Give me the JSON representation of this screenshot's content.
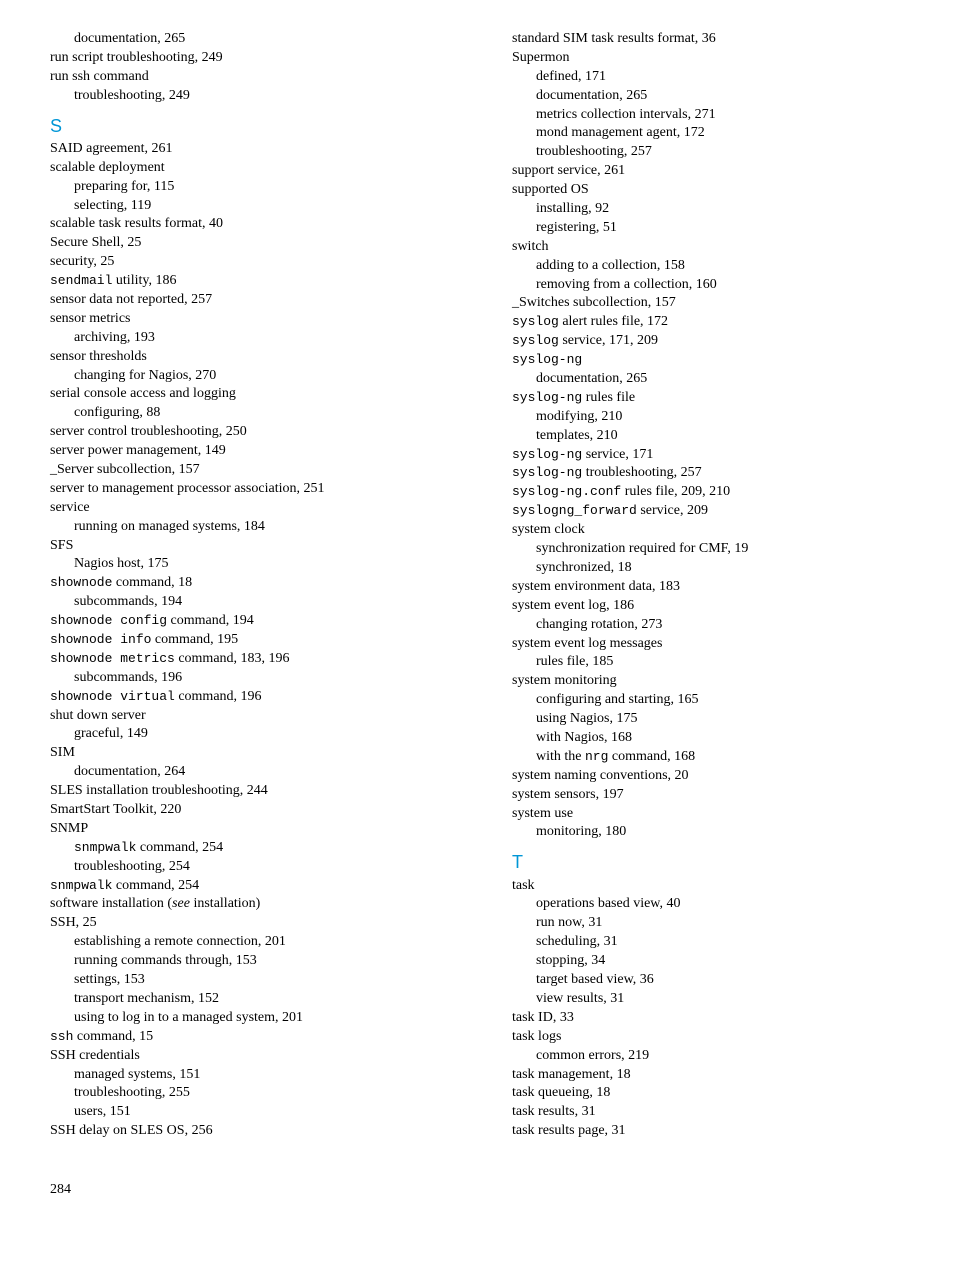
{
  "left": [
    {
      "t": "sub",
      "parts": [
        {
          "text": "documentation, 265"
        }
      ]
    },
    {
      "t": "entry",
      "parts": [
        {
          "text": "run script troubleshooting, 249"
        }
      ]
    },
    {
      "t": "entry",
      "parts": [
        {
          "text": "run ssh command"
        }
      ]
    },
    {
      "t": "sub",
      "parts": [
        {
          "text": "troubleshooting, 249"
        }
      ]
    },
    {
      "t": "head",
      "text": "S"
    },
    {
      "t": "entry",
      "parts": [
        {
          "text": "SAID agreement, 261"
        }
      ]
    },
    {
      "t": "entry",
      "parts": [
        {
          "text": "scalable deployment"
        }
      ]
    },
    {
      "t": "sub",
      "parts": [
        {
          "text": "preparing for, 115"
        }
      ]
    },
    {
      "t": "sub",
      "parts": [
        {
          "text": "selecting, 119"
        }
      ]
    },
    {
      "t": "entry",
      "parts": [
        {
          "text": "scalable task results format, 40"
        }
      ]
    },
    {
      "t": "entry",
      "parts": [
        {
          "text": "Secure Shell, 25"
        }
      ]
    },
    {
      "t": "entry",
      "parts": [
        {
          "text": "security, 25"
        }
      ]
    },
    {
      "t": "entry",
      "parts": [
        {
          "text": "sendmail",
          "mono": true
        },
        {
          "text": " utility, 186"
        }
      ]
    },
    {
      "t": "entry",
      "parts": [
        {
          "text": "sensor data not reported, 257"
        }
      ]
    },
    {
      "t": "entry",
      "parts": [
        {
          "text": "sensor metrics"
        }
      ]
    },
    {
      "t": "sub",
      "parts": [
        {
          "text": "archiving, 193"
        }
      ]
    },
    {
      "t": "entry",
      "parts": [
        {
          "text": "sensor thresholds"
        }
      ]
    },
    {
      "t": "sub",
      "parts": [
        {
          "text": "changing for Nagios, 270"
        }
      ]
    },
    {
      "t": "entry",
      "parts": [
        {
          "text": "serial console access and logging"
        }
      ]
    },
    {
      "t": "sub",
      "parts": [
        {
          "text": "configuring, 88"
        }
      ]
    },
    {
      "t": "entry",
      "parts": [
        {
          "text": "server control troubleshooting, 250"
        }
      ]
    },
    {
      "t": "entry",
      "parts": [
        {
          "text": "server power management, 149"
        }
      ]
    },
    {
      "t": "entry",
      "parts": [
        {
          "text": "_Server subcollection, 157"
        }
      ]
    },
    {
      "t": "entry",
      "parts": [
        {
          "text": "server to management processor association, 251"
        }
      ]
    },
    {
      "t": "entry",
      "parts": [
        {
          "text": "service"
        }
      ]
    },
    {
      "t": "sub",
      "parts": [
        {
          "text": "running on managed systems, 184"
        }
      ]
    },
    {
      "t": "entry",
      "parts": [
        {
          "text": "SFS"
        }
      ]
    },
    {
      "t": "sub",
      "parts": [
        {
          "text": "Nagios host, 175"
        }
      ]
    },
    {
      "t": "entry",
      "parts": [
        {
          "text": "shownode",
          "mono": true
        },
        {
          "text": " command, 18"
        }
      ]
    },
    {
      "t": "sub",
      "parts": [
        {
          "text": "subcommands, 194"
        }
      ]
    },
    {
      "t": "entry",
      "parts": [
        {
          "text": "shownode config",
          "mono": true
        },
        {
          "text": " command, 194"
        }
      ]
    },
    {
      "t": "entry",
      "parts": [
        {
          "text": "shownode info",
          "mono": true
        },
        {
          "text": " command, 195"
        }
      ]
    },
    {
      "t": "entry",
      "parts": [
        {
          "text": "shownode metrics",
          "mono": true
        },
        {
          "text": " command, 183, 196"
        }
      ]
    },
    {
      "t": "sub",
      "parts": [
        {
          "text": "subcommands, 196"
        }
      ]
    },
    {
      "t": "entry",
      "parts": [
        {
          "text": "shownode virtual",
          "mono": true
        },
        {
          "text": " command, 196"
        }
      ]
    },
    {
      "t": "entry",
      "parts": [
        {
          "text": "shut down server"
        }
      ]
    },
    {
      "t": "sub",
      "parts": [
        {
          "text": "graceful, 149"
        }
      ]
    },
    {
      "t": "entry",
      "parts": [
        {
          "text": "SIM"
        }
      ]
    },
    {
      "t": "sub",
      "parts": [
        {
          "text": "documentation, 264"
        }
      ]
    },
    {
      "t": "entry",
      "parts": [
        {
          "text": "SLES installation troubleshooting, 244"
        }
      ]
    },
    {
      "t": "entry",
      "parts": [
        {
          "text": "SmartStart Toolkit, 220"
        }
      ]
    },
    {
      "t": "entry",
      "parts": [
        {
          "text": "SNMP"
        }
      ]
    },
    {
      "t": "sub",
      "parts": [
        {
          "text": "snmpwalk",
          "mono": true
        },
        {
          "text": " command, 254"
        }
      ]
    },
    {
      "t": "sub",
      "parts": [
        {
          "text": "troubleshooting, 254"
        }
      ]
    },
    {
      "t": "entry",
      "parts": [
        {
          "text": "snmpwalk",
          "mono": true
        },
        {
          "text": " command, 254"
        }
      ]
    },
    {
      "t": "entry",
      "parts": [
        {
          "text": "software installation ("
        },
        {
          "text": "see",
          "italic": true
        },
        {
          "text": " installation)"
        }
      ]
    },
    {
      "t": "entry",
      "parts": [
        {
          "text": "SSH, 25"
        }
      ]
    },
    {
      "t": "sub",
      "parts": [
        {
          "text": "establishing a remote connection, 201"
        }
      ]
    },
    {
      "t": "sub",
      "parts": [
        {
          "text": "running commands through, 153"
        }
      ]
    },
    {
      "t": "sub",
      "parts": [
        {
          "text": "settings, 153"
        }
      ]
    },
    {
      "t": "sub",
      "parts": [
        {
          "text": "transport mechanism, 152"
        }
      ]
    },
    {
      "t": "sub",
      "parts": [
        {
          "text": "using to log in to a managed system, 201"
        }
      ]
    },
    {
      "t": "entry",
      "parts": [
        {
          "text": "ssh",
          "mono": true
        },
        {
          "text": " command, 15"
        }
      ]
    },
    {
      "t": "entry",
      "parts": [
        {
          "text": "SSH credentials"
        }
      ]
    },
    {
      "t": "sub",
      "parts": [
        {
          "text": "managed systems, 151"
        }
      ]
    },
    {
      "t": "sub",
      "parts": [
        {
          "text": "troubleshooting, 255"
        }
      ]
    },
    {
      "t": "sub",
      "parts": [
        {
          "text": "users, 151"
        }
      ]
    },
    {
      "t": "entry",
      "parts": [
        {
          "text": "SSH delay on SLES OS, 256"
        }
      ]
    }
  ],
  "right": [
    {
      "t": "entry",
      "parts": [
        {
          "text": "standard SIM task results format, 36"
        }
      ]
    },
    {
      "t": "entry",
      "parts": [
        {
          "text": "Supermon"
        }
      ]
    },
    {
      "t": "sub",
      "parts": [
        {
          "text": "defined, 171"
        }
      ]
    },
    {
      "t": "sub",
      "parts": [
        {
          "text": "documentation, 265"
        }
      ]
    },
    {
      "t": "sub",
      "parts": [
        {
          "text": "metrics collection intervals, 271"
        }
      ]
    },
    {
      "t": "sub",
      "parts": [
        {
          "text": "mond management agent, 172"
        }
      ]
    },
    {
      "t": "sub",
      "parts": [
        {
          "text": "troubleshooting, 257"
        }
      ]
    },
    {
      "t": "entry",
      "parts": [
        {
          "text": "support service, 261"
        }
      ]
    },
    {
      "t": "entry",
      "parts": [
        {
          "text": "supported OS"
        }
      ]
    },
    {
      "t": "sub",
      "parts": [
        {
          "text": "installing, 92"
        }
      ]
    },
    {
      "t": "sub",
      "parts": [
        {
          "text": "registering, 51"
        }
      ]
    },
    {
      "t": "entry",
      "parts": [
        {
          "text": "switch"
        }
      ]
    },
    {
      "t": "sub",
      "parts": [
        {
          "text": "adding to a collection, 158"
        }
      ]
    },
    {
      "t": "sub",
      "parts": [
        {
          "text": "removing from a collection, 160"
        }
      ]
    },
    {
      "t": "entry",
      "parts": [
        {
          "text": "_Switches subcollection, 157"
        }
      ]
    },
    {
      "t": "entry",
      "parts": [
        {
          "text": "syslog",
          "mono": true
        },
        {
          "text": " alert rules file, 172"
        }
      ]
    },
    {
      "t": "entry",
      "parts": [
        {
          "text": "syslog",
          "mono": true
        },
        {
          "text": " service, 171, 209"
        }
      ]
    },
    {
      "t": "entry",
      "parts": [
        {
          "text": "syslog-ng",
          "mono": true
        }
      ]
    },
    {
      "t": "sub",
      "parts": [
        {
          "text": "documentation, 265"
        }
      ]
    },
    {
      "t": "entry",
      "parts": [
        {
          "text": "syslog-ng",
          "mono": true
        },
        {
          "text": " rules file"
        }
      ]
    },
    {
      "t": "sub",
      "parts": [
        {
          "text": "modifying, 210"
        }
      ]
    },
    {
      "t": "sub",
      "parts": [
        {
          "text": "templates, 210"
        }
      ]
    },
    {
      "t": "entry",
      "parts": [
        {
          "text": "syslog-ng",
          "mono": true
        },
        {
          "text": " service, 171"
        }
      ]
    },
    {
      "t": "entry",
      "parts": [
        {
          "text": "syslog-ng",
          "mono": true
        },
        {
          "text": " troubleshooting, 257"
        }
      ]
    },
    {
      "t": "entry",
      "parts": [
        {
          "text": "syslog-ng.conf",
          "mono": true
        },
        {
          "text": " rules file, 209, 210"
        }
      ]
    },
    {
      "t": "entry",
      "parts": [
        {
          "text": "syslogng_forward",
          "mono": true
        },
        {
          "text": " service, 209"
        }
      ]
    },
    {
      "t": "entry",
      "parts": [
        {
          "text": "system clock"
        }
      ]
    },
    {
      "t": "sub",
      "parts": [
        {
          "text": "synchronization required for CMF, 19"
        }
      ]
    },
    {
      "t": "sub",
      "parts": [
        {
          "text": "synchronized, 18"
        }
      ]
    },
    {
      "t": "entry",
      "parts": [
        {
          "text": "system environment data, 183"
        }
      ]
    },
    {
      "t": "entry",
      "parts": [
        {
          "text": "system event log, 186"
        }
      ]
    },
    {
      "t": "sub",
      "parts": [
        {
          "text": "changing rotation, 273"
        }
      ]
    },
    {
      "t": "entry",
      "parts": [
        {
          "text": "system event log messages"
        }
      ]
    },
    {
      "t": "sub",
      "parts": [
        {
          "text": "rules file, 185"
        }
      ]
    },
    {
      "t": "entry",
      "parts": [
        {
          "text": "system monitoring"
        }
      ]
    },
    {
      "t": "sub",
      "parts": [
        {
          "text": "configuring and starting, 165"
        }
      ]
    },
    {
      "t": "sub",
      "parts": [
        {
          "text": "using Nagios, 175"
        }
      ]
    },
    {
      "t": "sub",
      "parts": [
        {
          "text": "with Nagios, 168"
        }
      ]
    },
    {
      "t": "sub",
      "parts": [
        {
          "text": "with the "
        },
        {
          "text": "nrg",
          "mono": true
        },
        {
          "text": " command, 168"
        }
      ]
    },
    {
      "t": "entry",
      "parts": [
        {
          "text": "system naming conventions, 20"
        }
      ]
    },
    {
      "t": "entry",
      "parts": [
        {
          "text": "system sensors, 197"
        }
      ]
    },
    {
      "t": "entry",
      "parts": [
        {
          "text": "system use"
        }
      ]
    },
    {
      "t": "sub",
      "parts": [
        {
          "text": "monitoring, 180"
        }
      ]
    },
    {
      "t": "head",
      "text": "T"
    },
    {
      "t": "entry",
      "parts": [
        {
          "text": "task"
        }
      ]
    },
    {
      "t": "sub",
      "parts": [
        {
          "text": "operations based view, 40"
        }
      ]
    },
    {
      "t": "sub",
      "parts": [
        {
          "text": "run now, 31"
        }
      ]
    },
    {
      "t": "sub",
      "parts": [
        {
          "text": "scheduling, 31"
        }
      ]
    },
    {
      "t": "sub",
      "parts": [
        {
          "text": "stopping, 34"
        }
      ]
    },
    {
      "t": "sub",
      "parts": [
        {
          "text": "target based view, 36"
        }
      ]
    },
    {
      "t": "sub",
      "parts": [
        {
          "text": "view results, 31"
        }
      ]
    },
    {
      "t": "entry",
      "parts": [
        {
          "text": "task ID, 33"
        }
      ]
    },
    {
      "t": "entry",
      "parts": [
        {
          "text": "task logs"
        }
      ]
    },
    {
      "t": "sub",
      "parts": [
        {
          "text": "common errors, 219"
        }
      ]
    },
    {
      "t": "entry",
      "parts": [
        {
          "text": "task management, 18"
        }
      ]
    },
    {
      "t": "entry",
      "parts": [
        {
          "text": "task queueing, 18"
        }
      ]
    },
    {
      "t": "entry",
      "parts": [
        {
          "text": "task results, 31"
        }
      ]
    },
    {
      "t": "entry",
      "parts": [
        {
          "text": "task results page, 31"
        }
      ]
    }
  ],
  "pageNumber": "284"
}
